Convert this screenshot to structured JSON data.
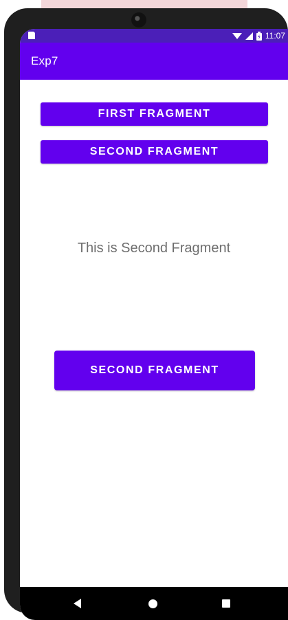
{
  "status_bar": {
    "time": "11:07",
    "icons": [
      "sd-card-icon",
      "wifi-icon",
      "signal-icon",
      "battery-icon"
    ]
  },
  "app_bar": {
    "title": "Exp7"
  },
  "buttons": {
    "first_fragment": "FIRST FRAGMENT",
    "second_fragment": "SECOND FRAGMENT"
  },
  "fragment": {
    "message": "This is Second Fragment",
    "button_label": "SECOND FRAGMENT"
  },
  "nav_bar": {
    "icons": [
      "back-icon",
      "home-icon",
      "recents-icon"
    ]
  },
  "colors": {
    "primary": "#6200ee",
    "status_bar": "#4b1fb8",
    "text_secondary": "#6e6e6e"
  }
}
